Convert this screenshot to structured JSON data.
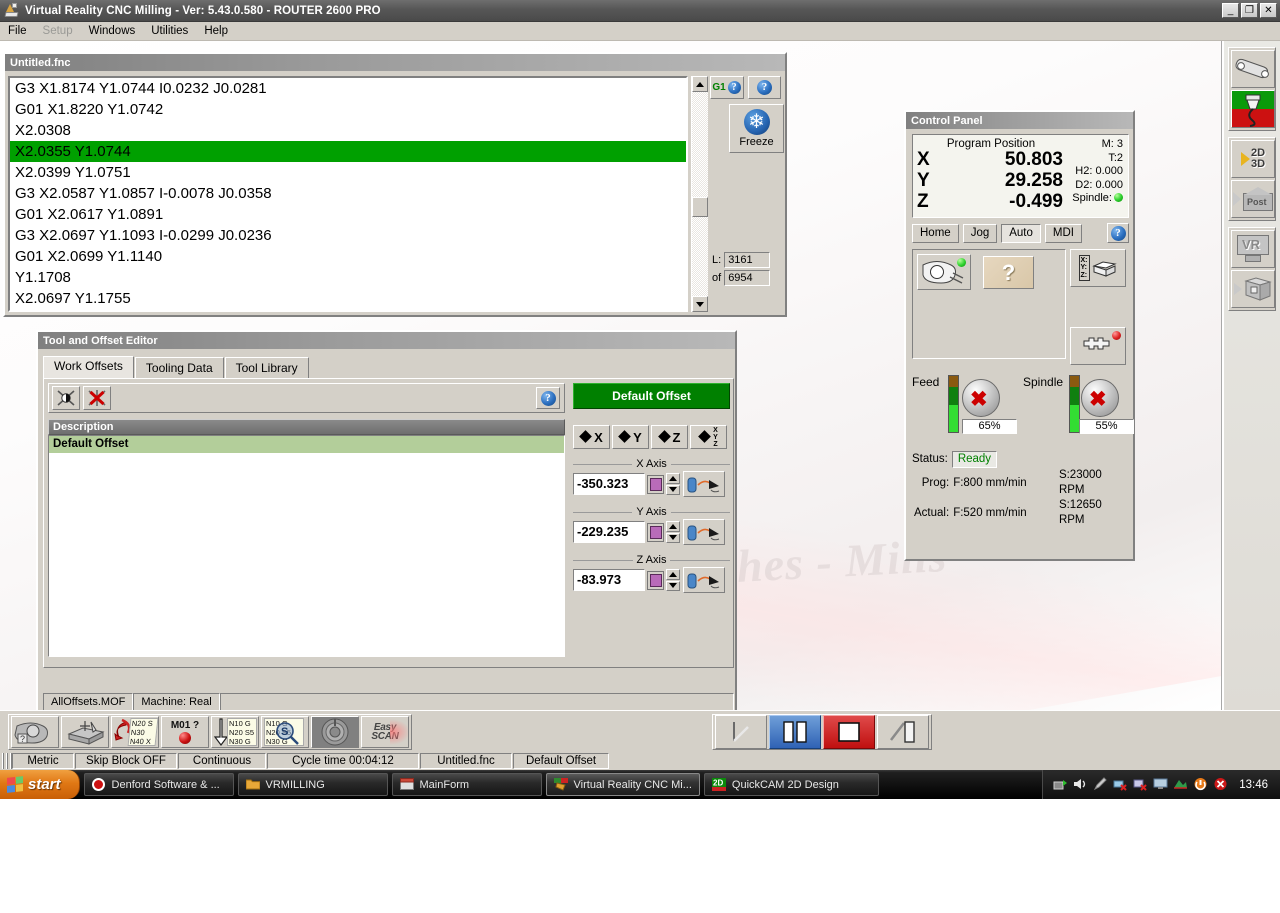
{
  "window": {
    "title": "Virtual Reality CNC Milling  -  Ver: 5.43.0.580 - ROUTER 2600 PRO",
    "minimize": "_",
    "maximize": "❐",
    "close": "✕"
  },
  "menu": {
    "items": [
      {
        "label": "File",
        "disabled": false
      },
      {
        "label": "Setup",
        "disabled": true
      },
      {
        "label": "Windows",
        "disabled": false
      },
      {
        "label": "Utilities",
        "disabled": false
      },
      {
        "label": "Help",
        "disabled": false
      }
    ]
  },
  "editor": {
    "title": "Untitled.fnc",
    "lines": [
      {
        "text": "G3 X1.8174 Y1.0744 I0.0232 J0.0281",
        "active": false
      },
      {
        "text": "G01 X1.8220 Y1.0742",
        "active": false
      },
      {
        "text": "X2.0308",
        "active": false
      },
      {
        "text": "X2.0355 Y1.0744",
        "active": true
      },
      {
        "text": "X2.0399 Y1.0751",
        "active": false
      },
      {
        "text": "G3 X2.0587 Y1.0857 I-0.0078 J0.0358",
        "active": false
      },
      {
        "text": "G01 X2.0617 Y1.0891",
        "active": false
      },
      {
        "text": "G3 X2.0697 Y1.1093 I-0.0299 J0.0236",
        "active": false
      },
      {
        "text": "G01 X2.0699 Y1.1140",
        "active": false
      },
      {
        "text": "Y1.1708",
        "active": false
      },
      {
        "text": "X2.0697 Y1.1755",
        "active": false
      }
    ],
    "goto_block_label": "G1",
    "help_label": "?",
    "freeze_label": "Freeze",
    "line_label": "L:",
    "line_value": "3161",
    "of_label": "of",
    "of_value": "6954",
    "accent_active_line": "#00A000"
  },
  "tool_editor": {
    "title": "Tool and Offset Editor",
    "tabs": [
      {
        "label": "Work Offsets",
        "active": true
      },
      {
        "label": "Tooling Data",
        "active": false
      },
      {
        "label": "Tool Library",
        "active": false
      }
    ],
    "toolbar": {
      "add_offset_label": "add-offset",
      "delete_offset_label": "delete-offset",
      "help_label": "?"
    },
    "list": {
      "column_header": "Description",
      "rows": [
        {
          "description": "Default Offset",
          "selected": true
        }
      ]
    },
    "offset_pane": {
      "title": "Default Offset",
      "title_color": "#008000",
      "jog_buttons": [
        "X",
        "Y",
        "Z",
        "XYZ"
      ],
      "axes": [
        {
          "legend": "X Axis",
          "value": "-350.323"
        },
        {
          "legend": "Y Axis",
          "value": "-229.235"
        },
        {
          "legend": "Z Axis",
          "value": "-83.973"
        }
      ]
    },
    "status": {
      "file": "AllOffsets.MOF",
      "machine": "Machine: Real"
    }
  },
  "control_panel": {
    "title": "Control Panel",
    "dro": {
      "heading": "Program Position",
      "axes": [
        {
          "axis": "X",
          "value": "50.803"
        },
        {
          "axis": "Y",
          "value": "29.258"
        },
        {
          "axis": "Z",
          "value": "-0.499"
        }
      ],
      "m_code": "M: 3",
      "t_code": "T:2",
      "h_offset": "H2: 0.000",
      "d_offset": "D2: 0.000",
      "spindle_label": "Spindle:",
      "spindle_led_color": "#2fd22f"
    },
    "modes": [
      {
        "label": "Home",
        "active": false
      },
      {
        "label": "Jog",
        "active": false
      },
      {
        "label": "Auto",
        "active": true
      },
      {
        "label": "MDI",
        "active": false
      }
    ],
    "mode_help": "?",
    "graphics": {
      "part_view_label": "part-view",
      "query_label": "?",
      "coords_label": "X: Y: Z:",
      "datum_label": "datum-set"
    },
    "feed_override": {
      "label": "Feed",
      "percent": "65%",
      "level": 65
    },
    "spindle_override": {
      "label": "Spindle",
      "percent": "55%",
      "level": 55
    },
    "status": {
      "status_label": "Status:",
      "status_value": "Ready",
      "status_color": "#008000",
      "prog_label": "Prog:",
      "prog_feed": "F:800 mm/min",
      "prog_speed": "S:23000 RPM",
      "actual_label": "Actual:",
      "actual_feed": "F:520 mm/min",
      "actual_speed": "S:12650 RPM"
    }
  },
  "right_toolbar": {
    "buttons": [
      {
        "name": "spanner-icon",
        "label": "spanner"
      },
      {
        "name": "cam-icon",
        "label": "CAM"
      },
      {
        "name": "twod-threed-icon",
        "label": "2D 3D"
      },
      {
        "name": "post-icon",
        "label": "Post"
      },
      {
        "name": "vr-icon",
        "label": "VR"
      },
      {
        "name": "view-3d-icon",
        "label": "3D view"
      }
    ],
    "labels": {
      "twod": "2D",
      "threed": "3D",
      "post": "Post",
      "vr": "VR"
    }
  },
  "bottom_toolbar": {
    "left_buttons": [
      {
        "name": "tool-query-button",
        "label": "tool-query"
      },
      {
        "name": "stock-setup-button",
        "label": "stock-setup"
      },
      {
        "name": "restart-block-button",
        "label": "N20 / N30 / N40"
      },
      {
        "name": "optional-stop-button",
        "label": "M01 ?"
      },
      {
        "name": "block-search-down-button",
        "label": "N10 / N20 / N30"
      },
      {
        "name": "block-search-find-button",
        "label": "N10 / N20 / N30"
      },
      {
        "name": "emergency-stop-button",
        "label": "emergency-stop"
      },
      {
        "name": "easy-scan-button",
        "label": "Easy SCAN"
      }
    ],
    "restart_lines": [
      "N20 S",
      "N30",
      "N40 X"
    ],
    "optional_stop_label": "M01 ?",
    "search_lines": [
      "N10 G",
      "N20 S5",
      "N30 G"
    ],
    "easyscan_top": "Easy",
    "easyscan_bottom": "SCAN",
    "right_buttons": [
      {
        "name": "single-step-button",
        "label": "single-step"
      },
      {
        "name": "feed-hold-button",
        "label": "feed-hold"
      },
      {
        "name": "cycle-stop-button",
        "label": "cycle-stop"
      },
      {
        "name": "cycle-start-button",
        "label": "cycle-start"
      }
    ]
  },
  "statusbar": {
    "cells": [
      "Metric",
      "Skip Block OFF",
      "Continuous",
      "Cycle time 00:04:12",
      "Untitled.fnc",
      "Default Offset"
    ]
  },
  "taskbar": {
    "start_label": "start",
    "items": [
      {
        "label": "Denford Software & ...",
        "icon": "opera-icon",
        "active": false
      },
      {
        "label": "VRMILLING",
        "icon": "folder-icon",
        "active": false
      },
      {
        "label": "MainForm",
        "icon": "window-icon",
        "active": false
      },
      {
        "label": "Virtual Reality CNC Mi...",
        "icon": "vrcnc-icon",
        "active": true
      },
      {
        "label": "QuickCAM 2D Design",
        "icon": "quickcam-icon",
        "active": false
      }
    ],
    "clock": "13:46",
    "tray_icons": [
      "safely-remove-icon",
      "volume-icon",
      "pen-icon",
      "network-disconnected-icon",
      "network-error-icon",
      "display-icon",
      "graphics-icon",
      "update-icon",
      "antivirus-icon"
    ]
  },
  "desktop": {
    "watermark": "CNC Lathes - Mills"
  }
}
